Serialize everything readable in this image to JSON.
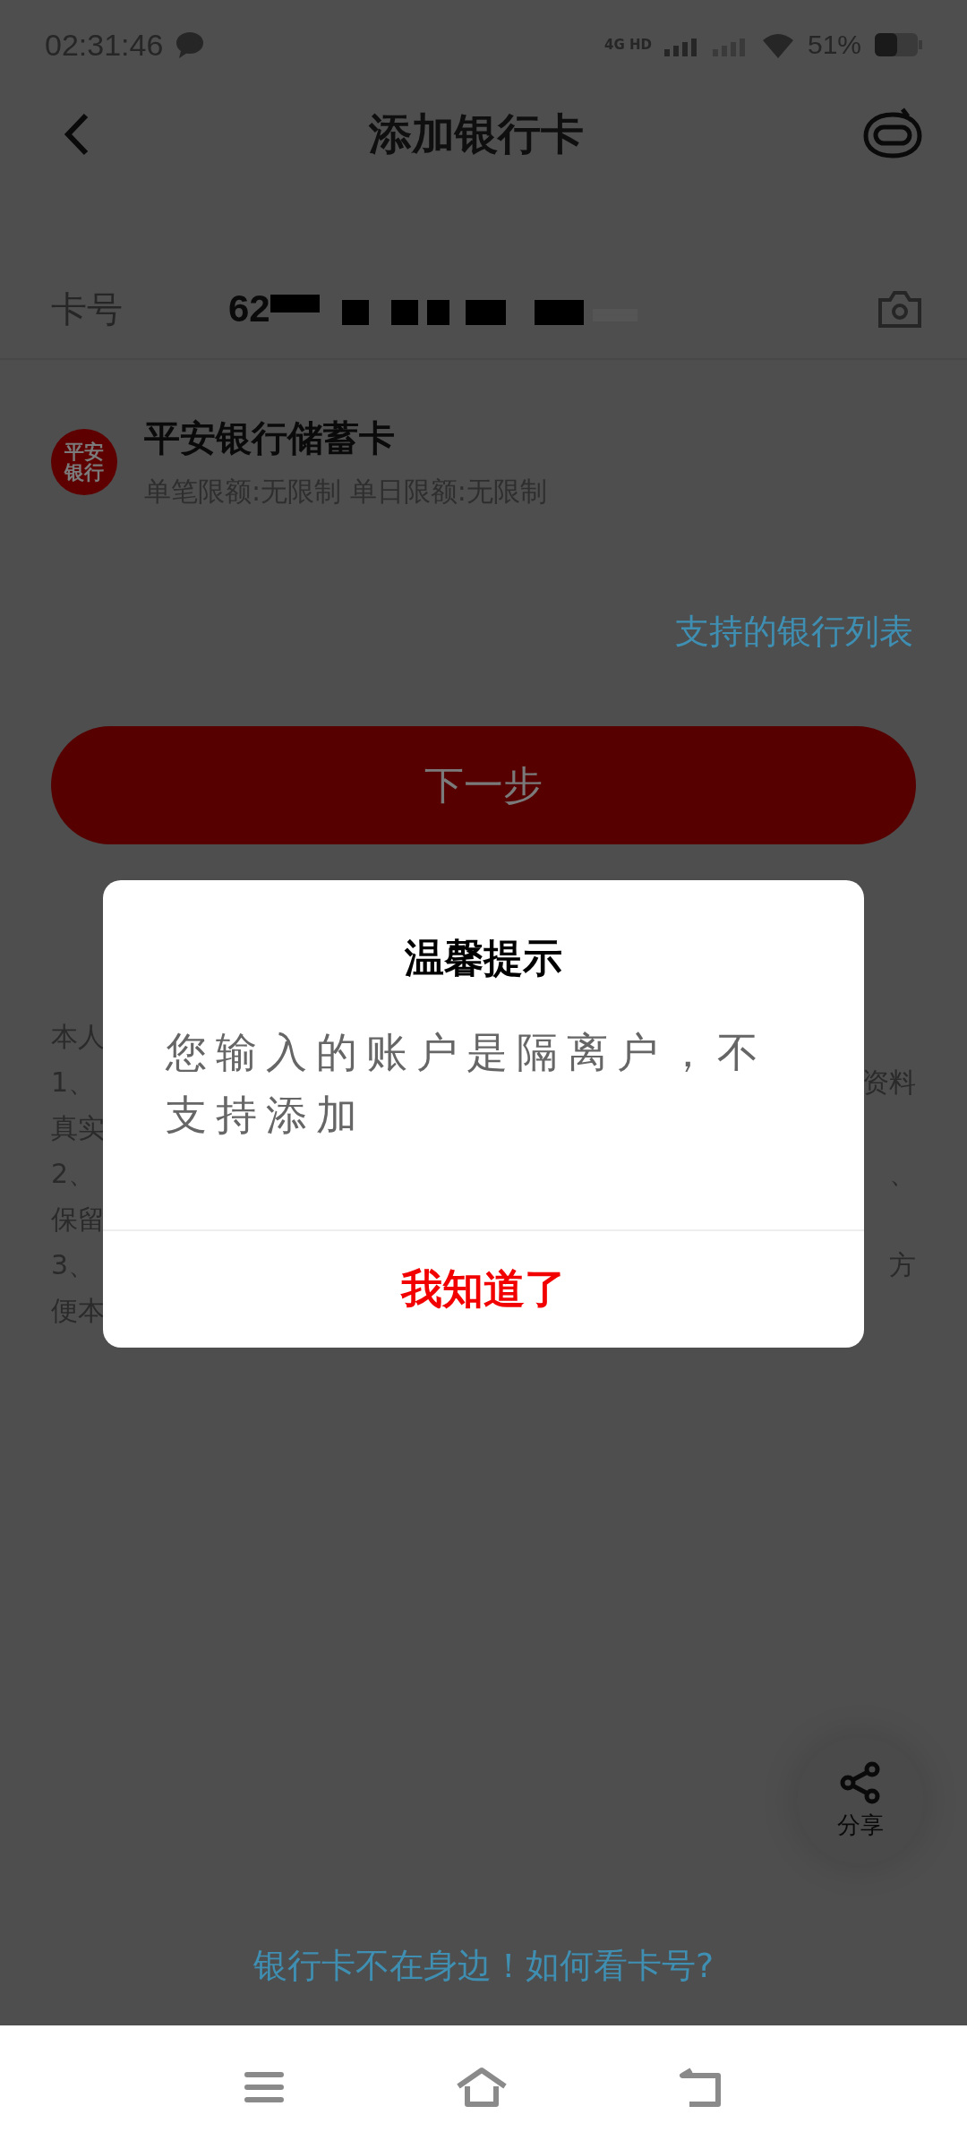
{
  "status_bar": {
    "time": "02:31:46",
    "network": "4G HD",
    "battery": "51%"
  },
  "header": {
    "title": "添加银行卡"
  },
  "card_field": {
    "label": "卡号",
    "value": "62"
  },
  "bank": {
    "logo_text": "平安银行",
    "name": "平安银行储蓄卡",
    "limits": "单笔限额:无限制 单日限额:无限制"
  },
  "supported_banks_link": "支持的银行列表",
  "next_button": {
    "label": "下一步",
    "disabled": true
  },
  "notes": [
    {
      "left": "本人"
    },
    {
      "left": "1、",
      "right": "资料"
    },
    {
      "left": "真实"
    },
    {
      "left": "2、",
      "right": "、"
    },
    {
      "left": "保留"
    },
    {
      "left": "3、",
      "right": "方"
    },
    {
      "left": "便本"
    }
  ],
  "share_button": {
    "label": "分享"
  },
  "help_link": "银行卡不在身边！如何看卡号?",
  "dialog": {
    "title": "温馨提示",
    "message": "您输入的账户是隔离户，不支持添加",
    "button": "我知道了"
  }
}
